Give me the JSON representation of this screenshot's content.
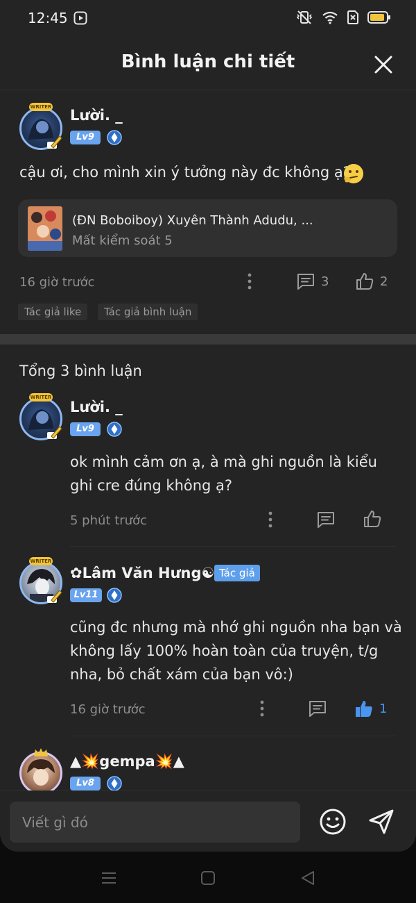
{
  "status_bar": {
    "time": "12:45"
  },
  "header": {
    "title": "Bình luận chi tiết"
  },
  "main_comment": {
    "username": "Lười. _",
    "level": "Lv9",
    "text": "cậu ơi, cho mình xin ý tưởng này đc không ạ?",
    "story": {
      "title": "(ĐN Boboiboy) Xuyên Thành Adudu, ...",
      "chapter": "Mất kiểm soát 5"
    },
    "time": "16 giờ trước",
    "reply_count": "3",
    "like_count": "2",
    "tags": [
      "Tác giả like",
      "Tác giả bình luận"
    ]
  },
  "replies_section": {
    "total_label": "Tổng 3 bình luận"
  },
  "replies": [
    {
      "username": "Lười. _",
      "level": "Lv9",
      "text": "ok mình cảm ơn ạ, à mà ghi nguồn là kiểu ghi cre đúng không ạ?",
      "time": "5 phút trước"
    },
    {
      "username": "✿Lâm Văn Hưng☯",
      "level": "Lv11",
      "author_tag": "Tác giả",
      "text": "cũng đc nhưng mà nhớ ghi nguồn nha bạn và không lấy 100% hoàn toàn của truyện, t/g nha, bỏ chất xám của bạn vô:)",
      "time": "16 giờ trước",
      "like_count": "1"
    },
    {
      "username": "▲💥gempa💥▲",
      "level": "Lv8"
    }
  ],
  "input": {
    "placeholder": "Viết gì đó"
  },
  "avatar_badge": "WRITER",
  "colors": {
    "accent": "#6aa4ee",
    "liked": "#4a95ef",
    "background": "#242424"
  }
}
